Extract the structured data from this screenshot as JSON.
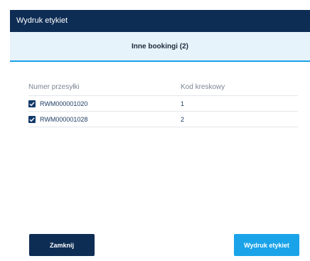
{
  "window": {
    "title": "Wydruk etykiet"
  },
  "tab": {
    "label": "Inne bookingi (2)"
  },
  "table": {
    "headers": [
      "Numer przesyłki",
      "Kod kreskowy"
    ],
    "rows": [
      {
        "checked": true,
        "shipment": "RWM000001020",
        "barcode": "1"
      },
      {
        "checked": true,
        "shipment": "RWM000001028",
        "barcode": "2"
      }
    ]
  },
  "buttons": {
    "close": "Zamknij",
    "print": "Wydruk etykiet"
  },
  "colors": {
    "header": "#0e2d55",
    "accent": "#1aa3e8",
    "tab_bg": "#e6f3fb"
  }
}
